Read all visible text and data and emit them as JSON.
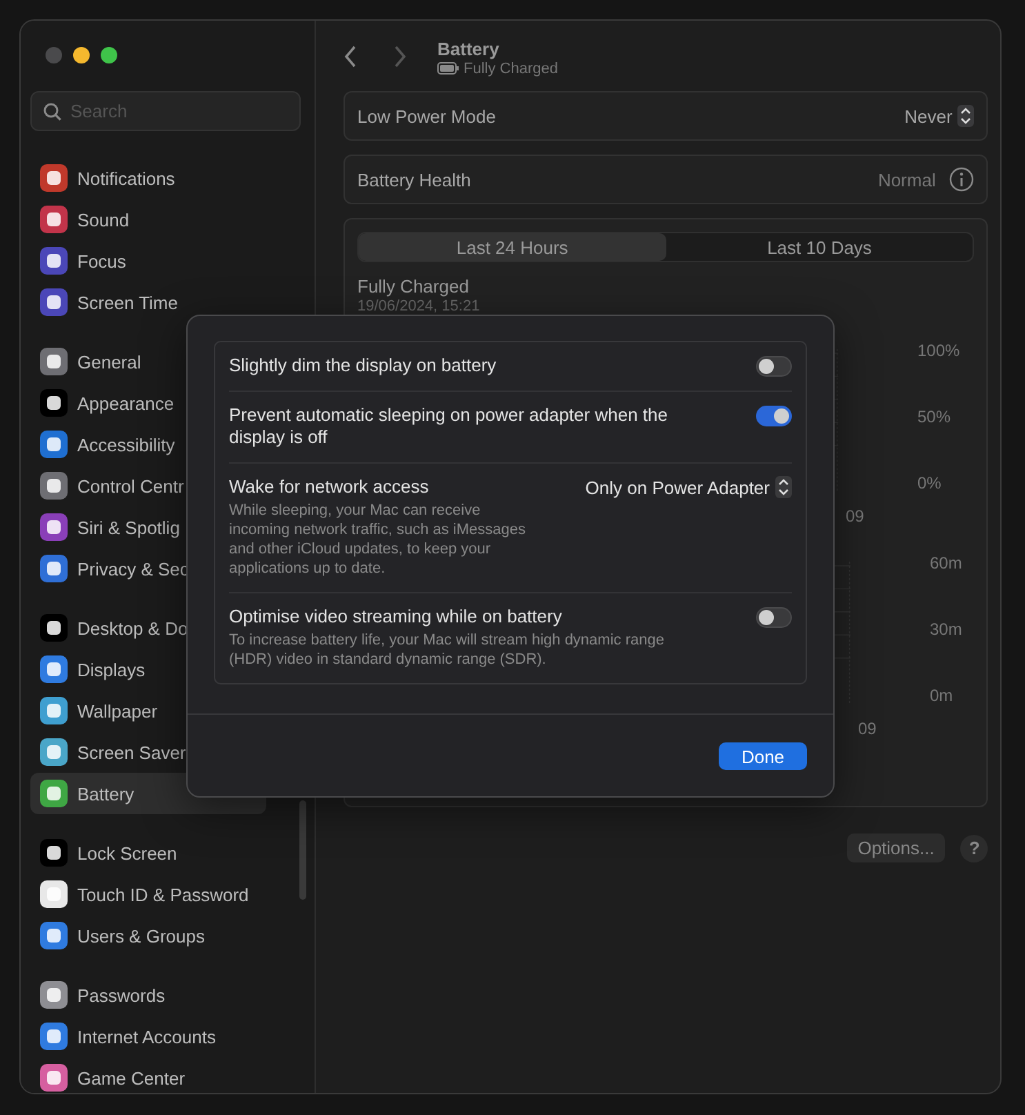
{
  "window": {
    "title": "Battery",
    "subtitle": "Fully Charged"
  },
  "sidebar": {
    "search": {
      "placeholder": "Search"
    },
    "groups": [
      {
        "items": [
          {
            "label": "Notifications",
            "color": "#c0392b",
            "selected": false
          },
          {
            "label": "Sound",
            "color": "#c2344a",
            "selected": false
          },
          {
            "label": "Focus",
            "color": "#4b47b8",
            "selected": false
          },
          {
            "label": "Screen Time",
            "color": "#4b47b8",
            "selected": false
          }
        ]
      },
      {
        "items": [
          {
            "label": "General",
            "color": "#6e6e73",
            "selected": false
          },
          {
            "label": "Appearance",
            "color": "#000000",
            "selected": false
          },
          {
            "label": "Accessibility",
            "color": "#1f6fd1",
            "selected": false
          },
          {
            "label": "Control Centr",
            "color": "#6e6e73",
            "selected": false
          },
          {
            "label": "Siri & Spotlig",
            "color": "#8a3fb8",
            "selected": false
          },
          {
            "label": "Privacy & Sec",
            "color": "#2f6fd6",
            "selected": false
          }
        ]
      },
      {
        "items": [
          {
            "label": "Desktop & Do",
            "color": "#000000",
            "selected": false
          },
          {
            "label": "Displays",
            "color": "#2f7be0",
            "selected": false
          },
          {
            "label": "Wallpaper",
            "color": "#3f9fd0",
            "selected": false
          },
          {
            "label": "Screen Saver",
            "color": "#4aa6c8",
            "selected": false
          },
          {
            "label": "Battery",
            "color": "#3fa744",
            "selected": true
          }
        ]
      },
      {
        "items": [
          {
            "label": "Lock Screen",
            "color": "#000000",
            "selected": false
          },
          {
            "label": "Touch ID & Password",
            "color": "#e8e8e8",
            "selected": false
          },
          {
            "label": "Users & Groups",
            "color": "#2f7be0",
            "selected": false
          }
        ]
      },
      {
        "items": [
          {
            "label": "Passwords",
            "color": "#8e8e93",
            "selected": false
          },
          {
            "label": "Internet Accounts",
            "color": "#2f7be0",
            "selected": false
          },
          {
            "label": "Game Center",
            "color": "#d65fa0",
            "selected": false
          }
        ]
      }
    ]
  },
  "settings": [
    {
      "label": "Low Power Mode",
      "value": "Never",
      "kind": "popup"
    },
    {
      "label": "Battery Health",
      "value": "Normal",
      "kind": "info"
    }
  ],
  "usage": {
    "tabs": [
      {
        "label": "Last 24 Hours",
        "selected": true
      },
      {
        "label": "Last 10 Days",
        "selected": false
      }
    ],
    "status": "Fully Charged",
    "time": "19/06/2024, 15:21",
    "charts": [
      {
        "ticks": [
          "100%",
          "50%",
          "0%"
        ],
        "hour": "09",
        "kind": "level"
      },
      {
        "ticks": [
          "60m",
          "30m",
          "0m"
        ],
        "hour": "09",
        "kind": "usage"
      }
    ]
  },
  "options_button": "Options...",
  "help_button": "?",
  "dialog": {
    "rows": [
      {
        "kind": "toggle",
        "title": "Slightly dim the display on battery",
        "on": false
      },
      {
        "kind": "toggle",
        "title": "Prevent automatic sleeping on power adapter when the display is off",
        "on": true
      },
      {
        "kind": "popup",
        "title": "Wake for network access",
        "description": "While sleeping, your Mac can receive incoming network traffic, such as iMessages and other iCloud updates, to keep your applications up to date.",
        "value": "Only on Power Adapter"
      },
      {
        "kind": "toggle",
        "title": "Optimise video streaming while on battery",
        "description": "To increase battery life, your Mac will stream high dynamic range (HDR) video in standard dynamic range (SDR).",
        "on": false
      }
    ],
    "done_button": "Done"
  }
}
